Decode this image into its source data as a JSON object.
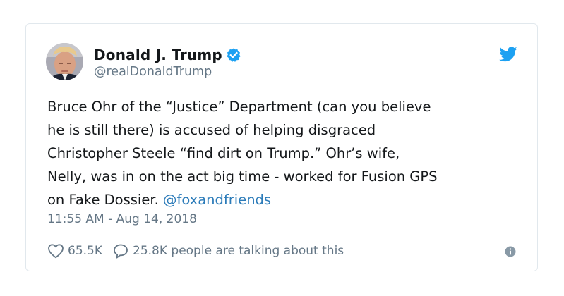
{
  "tweet": {
    "author": {
      "display_name": "Donald J. Trump",
      "handle": "@realDonaldTrump",
      "verified": true,
      "avatar_icon": "profile-photo"
    },
    "text_lines": [
      "Bruce Ohr of the “Justice” Department (can you believe",
      "he is still there) is accused of helping disgraced",
      "Christopher Steele “find dirt on Trump.” Ohr’s wife,",
      "Nelly, was in on the act big time - worked for Fusion GPS",
      "on Fake Dossier."
    ],
    "mention": "@foxandfriends",
    "timestamp": "11:55 AM - Aug 14, 2018",
    "likes": "65.5K",
    "replies_text": "25.8K people are talking about this"
  },
  "icons": {
    "brand": "twitter-bird-icon",
    "verified": "verified-badge-icon",
    "like": "heart-icon",
    "reply": "speech-bubble-icon",
    "info": "info-icon"
  },
  "colors": {
    "brand_blue": "#1da1f2",
    "link_blue": "#2b7bb9",
    "text_primary": "#14171a",
    "text_secondary": "#657786",
    "border": "#e1e8ed"
  }
}
